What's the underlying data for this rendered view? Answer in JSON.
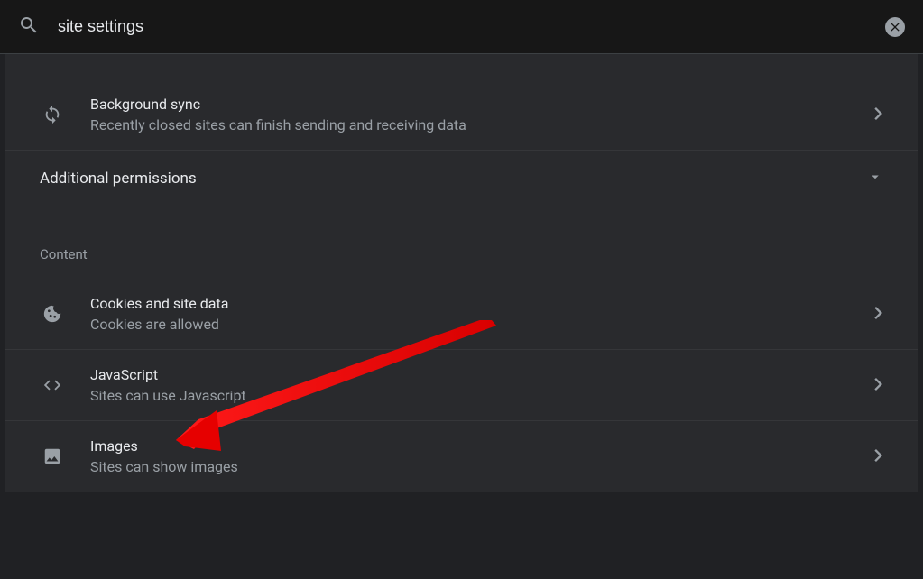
{
  "search": {
    "value": "site settings"
  },
  "items": {
    "background_sync": {
      "title": "Background sync",
      "subtitle": "Recently closed sites can finish sending and receiving data"
    },
    "cookies": {
      "title": "Cookies and site data",
      "subtitle": "Cookies are allowed"
    },
    "javascript": {
      "title": "JavaScript",
      "subtitle": "Sites can use Javascript"
    },
    "images": {
      "title": "Images",
      "subtitle": "Sites can show images"
    }
  },
  "sections": {
    "additional_permissions": "Additional permissions",
    "content": "Content"
  }
}
